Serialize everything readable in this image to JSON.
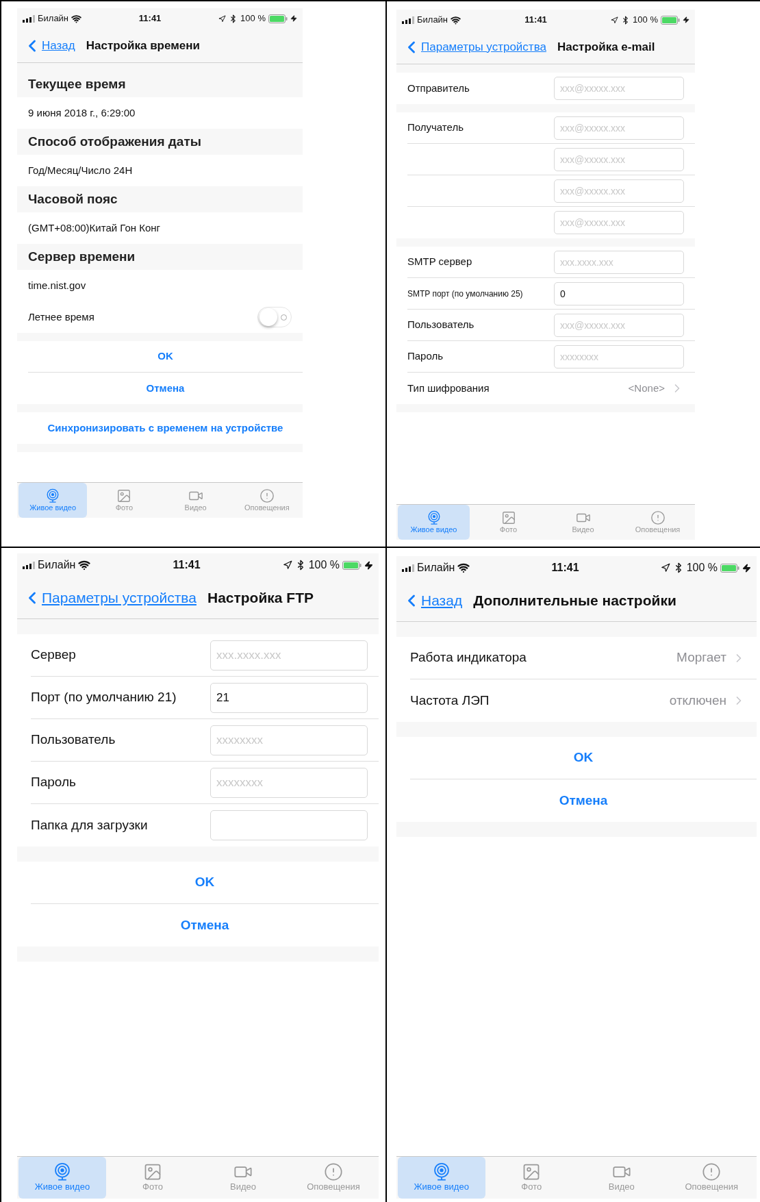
{
  "screens": [
    {
      "status": {
        "carrier": "Билайн",
        "time": "11:41",
        "battery": "100 %"
      },
      "nav": {
        "back": "Назад",
        "title": "Настройка времени"
      },
      "groups": [
        [
          {
            "kind": "header",
            "label": "Текущее время"
          },
          {
            "kind": "text",
            "label": "9 июня 2018 г., 6:29:00"
          },
          {
            "kind": "header",
            "label": "Способ отображения даты"
          },
          {
            "kind": "text",
            "label": "Год/Месяц/Число 24H"
          },
          {
            "kind": "header",
            "label": "Часовой пояс"
          },
          {
            "kind": "text",
            "label": "(GMT+08:00)Китай Гон Конг"
          },
          {
            "kind": "header",
            "label": "Сервер времени"
          },
          {
            "kind": "text",
            "label": "time.nist.gov"
          },
          {
            "kind": "toggle",
            "label": "Летнее время",
            "on": false
          }
        ],
        [
          {
            "kind": "action",
            "label": "OK"
          },
          {
            "kind": "action",
            "label": "Отмена"
          }
        ],
        [
          {
            "kind": "action",
            "label": "Синхронизировать с временем на устройстве"
          }
        ]
      ],
      "tabs": [
        {
          "label": "Живое видео",
          "selected": true
        },
        {
          "label": "Фото",
          "selected": false
        },
        {
          "label": "Видео",
          "selected": false
        },
        {
          "label": "Оповещения",
          "selected": false
        }
      ]
    },
    {
      "status": {
        "carrier": "Билайн",
        "time": "11:41",
        "battery": "100 %"
      },
      "nav": {
        "back": "Параметры устройства",
        "title": "Настройка e-mail"
      },
      "groups": [
        [
          {
            "kind": "field",
            "label": "Отправитель",
            "placeholder": "xxx@xxxxx.xxx"
          }
        ],
        [
          {
            "kind": "field",
            "label": "Получатель",
            "placeholder": "xxx@xxxxx.xxx"
          },
          {
            "kind": "field",
            "placeholder": "xxx@xxxxx.xxx"
          },
          {
            "kind": "field",
            "placeholder": "xxx@xxxxx.xxx"
          },
          {
            "kind": "field",
            "placeholder": "xxx@xxxxx.xxx"
          }
        ],
        [
          {
            "kind": "field",
            "label": "SMTP сервер",
            "placeholder": "xxx.xxxx.xxx"
          },
          {
            "kind": "field",
            "label": "SMTP порт (по умолчанию 25)",
            "value": "0"
          },
          {
            "kind": "field",
            "label": "Пользователь",
            "placeholder": "xxx@xxxxx.xxx"
          },
          {
            "kind": "field",
            "label": "Пароль",
            "placeholder": "xxxxxxxx"
          },
          {
            "kind": "option",
            "label": "Тип шифрования",
            "value": "<None>"
          }
        ]
      ],
      "tabs": [
        {
          "label": "Живое видео",
          "selected": true
        },
        {
          "label": "Фото",
          "selected": false
        },
        {
          "label": "Видео",
          "selected": false
        },
        {
          "label": "Оповещения",
          "selected": false
        }
      ]
    },
    {
      "status": {
        "carrier": "Билайн",
        "time": "11:41",
        "battery": "100 %"
      },
      "nav": {
        "back": "Параметры устройства",
        "title": "Настройка FTP"
      },
      "groups": [
        [
          {
            "kind": "field",
            "label": "Сервер",
            "placeholder": "xxx.xxxx.xxx"
          },
          {
            "kind": "field",
            "label": "Порт (по умолчанию 21)",
            "value": "21"
          },
          {
            "kind": "field",
            "label": "Пользователь",
            "placeholder": "xxxxxxxx"
          },
          {
            "kind": "field",
            "label": "Пароль",
            "placeholder": "xxxxxxxx"
          },
          {
            "kind": "field",
            "label": "Папка для загрузки"
          }
        ],
        [
          {
            "kind": "action",
            "label": "OK"
          },
          {
            "kind": "action",
            "label": "Отмена"
          }
        ]
      ],
      "tabs": [
        {
          "label": "Живое видео",
          "selected": true
        },
        {
          "label": "Фото",
          "selected": false
        },
        {
          "label": "Видео",
          "selected": false
        },
        {
          "label": "Оповещения",
          "selected": false
        }
      ]
    },
    {
      "status": {
        "carrier": "Билайн",
        "time": "11:41",
        "battery": "100 %"
      },
      "nav": {
        "back": "Назад",
        "title": "Дополнительные настройки"
      },
      "groups": [
        [
          {
            "kind": "option",
            "label": "Работа индикатора",
            "value": "Моргает"
          },
          {
            "kind": "option",
            "label": "Частота ЛЭП",
            "value": "отключен"
          }
        ],
        [
          {
            "kind": "action",
            "label": "OK"
          },
          {
            "kind": "action",
            "label": "Отмена"
          }
        ]
      ],
      "tabs": [
        {
          "label": "Живое видео",
          "selected": true
        },
        {
          "label": "Фото",
          "selected": false
        },
        {
          "label": "Видео",
          "selected": false
        },
        {
          "label": "Оповещения",
          "selected": false
        }
      ]
    }
  ]
}
